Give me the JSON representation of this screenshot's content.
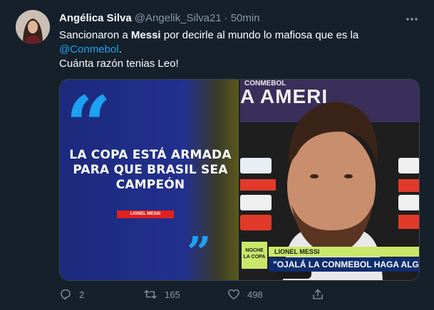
{
  "tweet": {
    "author": {
      "name": "Angélica Silva",
      "handle": "@Angelik_Silva21",
      "separator": "·",
      "time": "50min"
    },
    "text": {
      "line1_pre": "Sancionaron a ",
      "line1_bold": "Messi",
      "line1_post": " por decirle al mundo lo mafiosa que es la",
      "mention": "@Conmebol",
      "mention_suffix": ".",
      "line3": "Cuánta razón tenias Leo!"
    },
    "media": {
      "quote_open": "“",
      "quote_close": "”",
      "quote_text": "LA COPA ESTÁ ARMADA PARA QUE BRASIL SEA CAMPEÓN",
      "quote_author": "LIONEL MESSI",
      "banner_top": "CONMEBOL",
      "banner_big": "A AMERI",
      "side_tag": "NOCHE LA COPA",
      "caption_name": "LIONEL MESSI",
      "caption_quote": "\"OJALÁ LA CONMEBOL HAGA ALGO CON"
    },
    "actions": {
      "reply_count": "2",
      "retweet_count": "165",
      "like_count": "498"
    }
  },
  "colors": {
    "background": "#15202b",
    "accent": "#1da1f2",
    "muted": "#8899a6"
  },
  "icons": [
    "more-icon",
    "reply-icon",
    "retweet-icon",
    "like-icon",
    "share-icon"
  ]
}
